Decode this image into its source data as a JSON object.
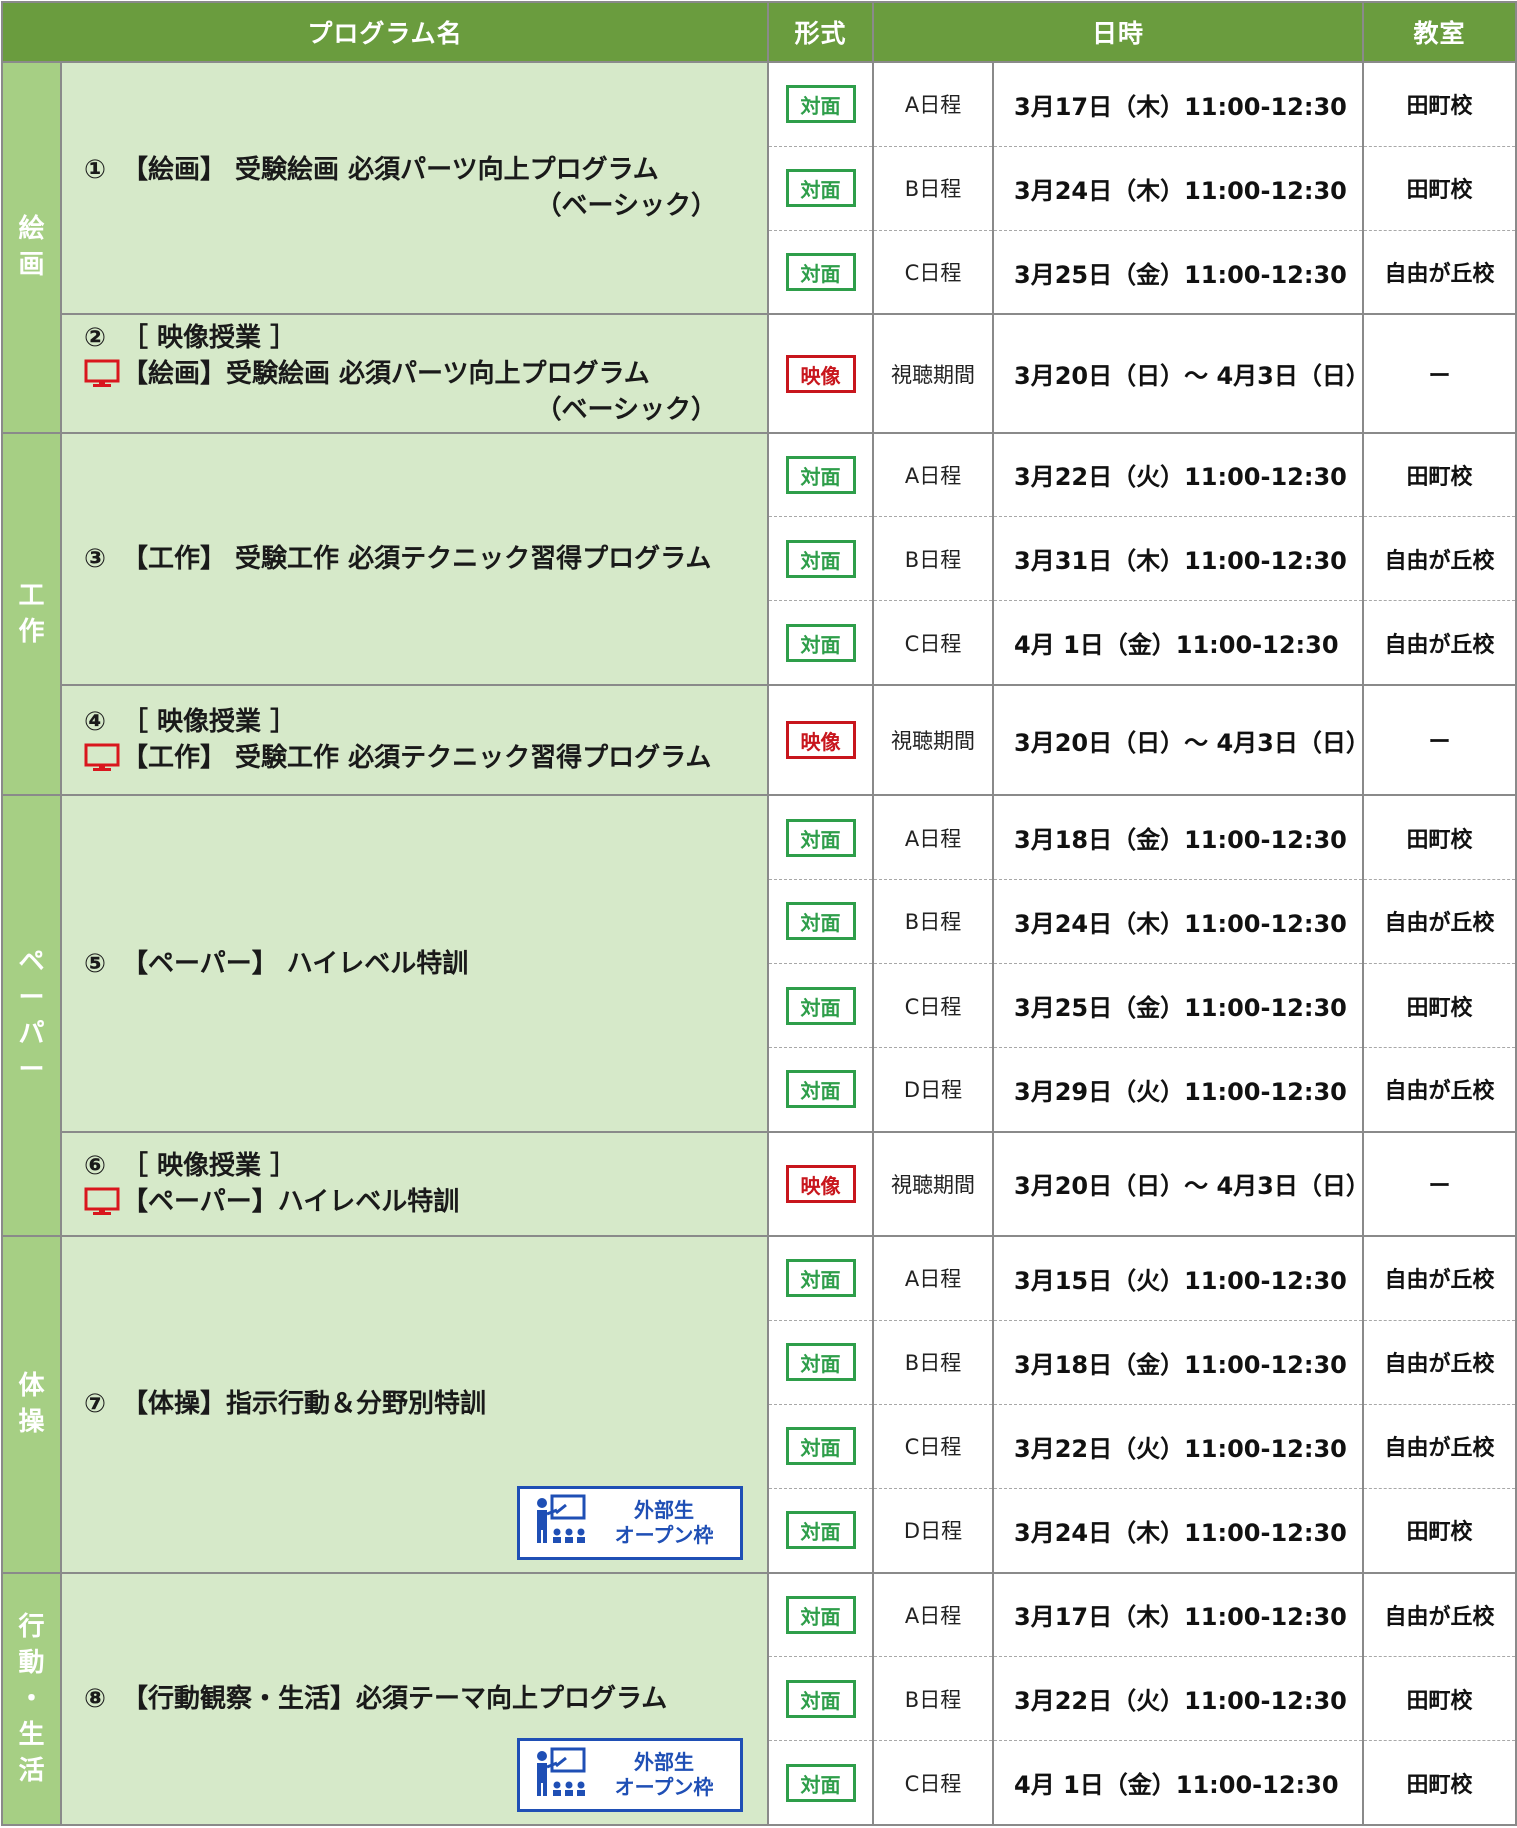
{
  "header": {
    "program": "プログラム名",
    "format": "形式",
    "datetime": "日時",
    "room": "教室"
  },
  "open_badge": {
    "line1": "外部生",
    "line2": "オープン枠"
  },
  "groups": [
    {
      "category_chars": [
        "絵",
        "画"
      ],
      "programs": [
        {
          "num": "①",
          "lines": [
            "【絵画】 受験絵画 必須パーツ向上プログラム",
            "（ベーシック）"
          ],
          "sessions": [
            {
              "format": "対面",
              "label": "A日程",
              "datetime": "3月17日（木）11:00-12:30",
              "room": "田町校"
            },
            {
              "format": "対面",
              "label": "B日程",
              "datetime": "3月24日（木）11:00-12:30",
              "room": "田町校"
            },
            {
              "format": "対面",
              "label": "C日程",
              "datetime": "3月25日（金）11:00-12:30",
              "room": "自由が丘校"
            }
          ]
        },
        {
          "num": "②",
          "lines": [
            "［ 映像授業 ］",
            "【絵画】受験絵画 必須パーツ向上プログラム",
            "（ベーシック）"
          ],
          "sessions": [
            {
              "format": "映像",
              "label": "視聴期間",
              "datetime": "3月20日（日）～ 4月3日（日）",
              "room": "ー"
            }
          ]
        }
      ]
    },
    {
      "category_chars": [
        "工",
        "作"
      ],
      "programs": [
        {
          "num": "③",
          "lines": [
            "【工作】 受験工作 必須テクニック習得プログラム"
          ],
          "sessions": [
            {
              "format": "対面",
              "label": "A日程",
              "datetime": "3月22日（火）11:00-12:30",
              "room": "田町校"
            },
            {
              "format": "対面",
              "label": "B日程",
              "datetime": "3月31日（木）11:00-12:30",
              "room": "自由が丘校"
            },
            {
              "format": "対面",
              "label": "C日程",
              "datetime": "4月 1日（金）11:00-12:30",
              "room": "自由が丘校"
            }
          ]
        },
        {
          "num": "④",
          "lines": [
            "［ 映像授業 ］",
            "【工作】 受験工作 必須テクニック習得プログラム"
          ],
          "sessions": [
            {
              "format": "映像",
              "label": "視聴期間",
              "datetime": "3月20日（日）～ 4月3日（日）",
              "room": "ー"
            }
          ]
        }
      ]
    },
    {
      "category_chars": [
        "ペ",
        "ー",
        "パ",
        "ー"
      ],
      "programs": [
        {
          "num": "⑤",
          "lines": [
            "【ペーパー】 ハイレベル特訓"
          ],
          "sessions": [
            {
              "format": "対面",
              "label": "A日程",
              "datetime": "3月18日（金）11:00-12:30",
              "room": "田町校"
            },
            {
              "format": "対面",
              "label": "B日程",
              "datetime": "3月24日（木）11:00-12:30",
              "room": "自由が丘校"
            },
            {
              "format": "対面",
              "label": "C日程",
              "datetime": "3月25日（金）11:00-12:30",
              "room": "田町校"
            },
            {
              "format": "対面",
              "label": "D日程",
              "datetime": "3月29日（火）11:00-12:30",
              "room": "自由が丘校"
            }
          ]
        },
        {
          "num": "⑥",
          "lines": [
            "［ 映像授業 ］",
            "【ペーパー】ハイレベル特訓"
          ],
          "sessions": [
            {
              "format": "映像",
              "label": "視聴期間",
              "datetime": "3月20日（日）～ 4月3日（日）",
              "room": "ー"
            }
          ]
        }
      ]
    },
    {
      "category_chars": [
        "体",
        "操"
      ],
      "programs": [
        {
          "num": "⑦",
          "lines": [
            "【体操】指示行動＆分野別特訓"
          ],
          "open": true,
          "sessions": [
            {
              "format": "対面",
              "label": "A日程",
              "datetime": "3月15日（火）11:00-12:30",
              "room": "自由が丘校"
            },
            {
              "format": "対面",
              "label": "B日程",
              "datetime": "3月18日（金）11:00-12:30",
              "room": "自由が丘校"
            },
            {
              "format": "対面",
              "label": "C日程",
              "datetime": "3月22日（火）11:00-12:30",
              "room": "自由が丘校"
            },
            {
              "format": "対面",
              "label": "D日程",
              "datetime": "3月24日（木）11:00-12:30",
              "room": "田町校"
            }
          ]
        }
      ]
    },
    {
      "category_chars": [
        "行",
        "動",
        "・",
        "生",
        "活"
      ],
      "programs": [
        {
          "num": "⑧",
          "lines": [
            "【行動観察・生活】必須テーマ向上プログラム"
          ],
          "open": true,
          "sessions": [
            {
              "format": "対面",
              "label": "A日程",
              "datetime": "3月17日（木）11:00-12:30",
              "room": "自由が丘校"
            },
            {
              "format": "対面",
              "label": "B日程",
              "datetime": "3月22日（火）11:00-12:30",
              "room": "田町校"
            },
            {
              "format": "対面",
              "label": "C日程",
              "datetime": "4月 1日（金）11:00-12:30",
              "room": "田町校"
            }
          ]
        }
      ]
    }
  ],
  "colors": {
    "header_bg": "#6a9c3e",
    "category_bg": "#a6cf84",
    "program_bg": "#d6e9c9",
    "in_person_badge": "#2e9e4a",
    "video_badge": "#c8161d",
    "open_badge": "#1f4fb5",
    "monitor_icon": "#d9161d"
  },
  "icons": {
    "video_program": "monitor-icon",
    "open_slot": "teacher-presentation-icon"
  }
}
